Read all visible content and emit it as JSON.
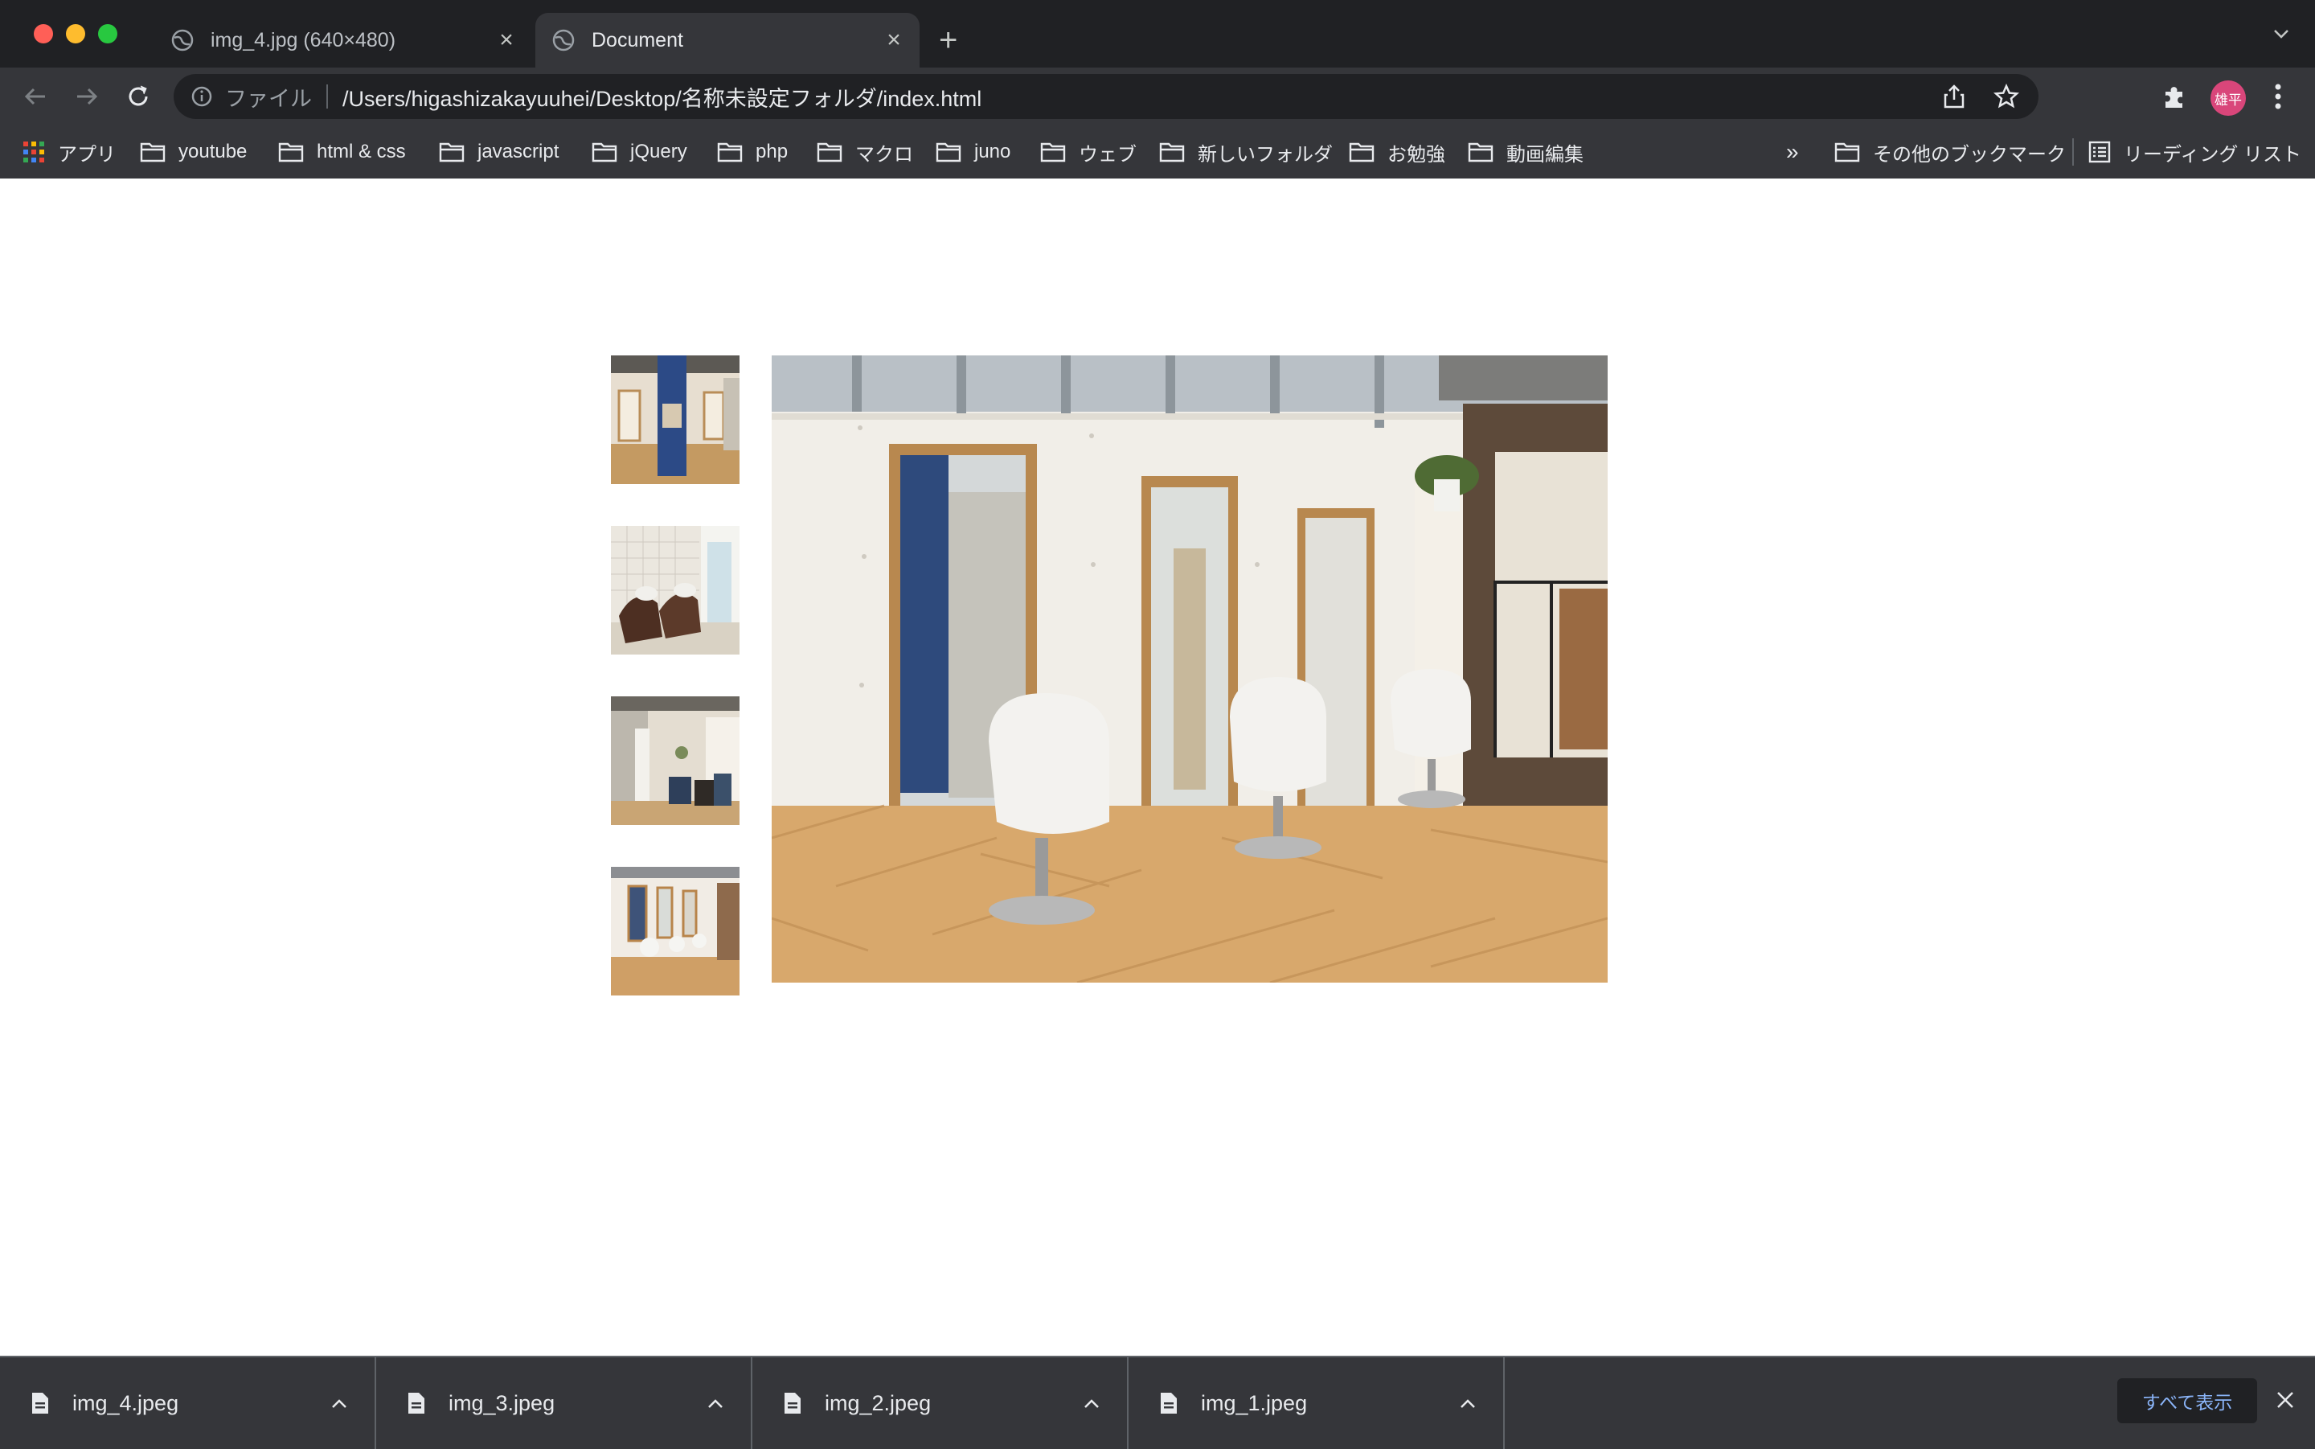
{
  "window": {
    "tabs": [
      {
        "title": "img_4.jpg (640×480)",
        "active": false
      },
      {
        "title": "Document",
        "active": true
      }
    ]
  },
  "toolbar": {
    "scheme_label": "ファイル",
    "url": "/Users/higashizakayuuhei/Desktop/名称未設定フォルダ/index.html",
    "avatar_text": "雄平"
  },
  "bookmarks": {
    "apps_label": "アプリ",
    "items": [
      "youtube",
      "html & css",
      "javascript",
      "jQuery",
      "php",
      "マクロ",
      "juno",
      "ウェブ",
      "新しいフォルダ",
      "お勉強",
      "動画編集"
    ],
    "overflow": "»",
    "other_label": "その他のブックマーク",
    "reading_list_label": "リーディング リスト"
  },
  "downloads": {
    "items": [
      "img_4.jpeg",
      "img_3.jpeg",
      "img_2.jpeg",
      "img_1.jpeg"
    ],
    "show_all_label": "すべて表示"
  },
  "colors": {
    "tab_strip": "#202124",
    "toolbar": "#35363a",
    "link_blue": "#8ab4f8",
    "avatar": "#d9467a"
  }
}
